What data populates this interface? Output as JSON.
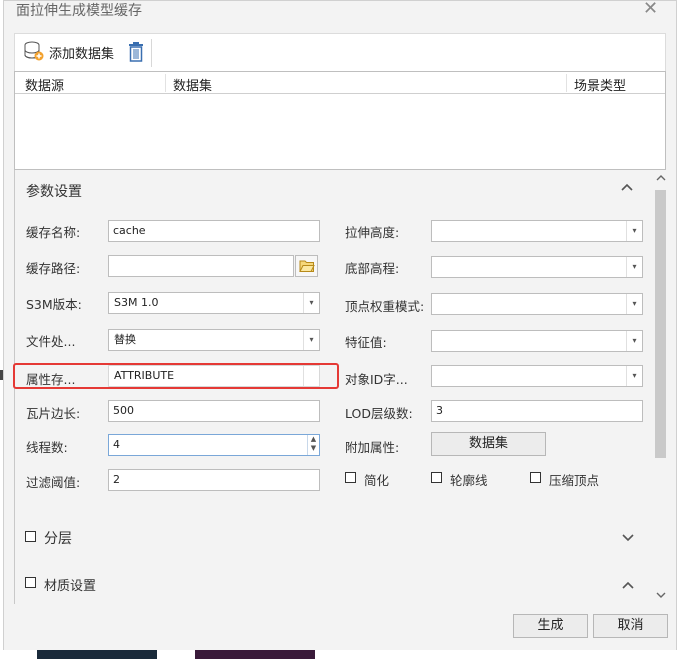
{
  "window": {
    "title": "面拉伸生成模型缓存",
    "close_glyph": "✕"
  },
  "toolbar": {
    "add_dataset_label": "添加数据集"
  },
  "dataset_table": {
    "columns": [
      "数据源",
      "数据集",
      "场景类型"
    ]
  },
  "params": {
    "section_title": "参数设置",
    "cache_name": {
      "label": "缓存名称:",
      "value": "cache"
    },
    "cache_path": {
      "label": "缓存路径:",
      "value": ""
    },
    "s3m_version": {
      "label": "S3M版本:",
      "value": "S3M 1.0"
    },
    "file_handling": {
      "label": "文件处...",
      "value": "替换"
    },
    "attr_storage": {
      "label": "属性存...",
      "value": "ATTRIBUTE"
    },
    "tile_side": {
      "label": "瓦片边长:",
      "value": "500"
    },
    "thread_count": {
      "label": "线程数:",
      "value": "4"
    },
    "filter_threshold": {
      "label": "过滤阈值:",
      "value": "2"
    },
    "extrude_height": {
      "label": "拉伸高度:",
      "value": ""
    },
    "base_elevation": {
      "label": "底部高程:",
      "value": ""
    },
    "vertex_weight_mode": {
      "label": "顶点权重模式:",
      "value": ""
    },
    "feature_value": {
      "label": "特征值:",
      "value": ""
    },
    "object_id_field": {
      "label": "对象ID字...",
      "value": ""
    },
    "lod_levels": {
      "label": "LOD层级数:",
      "value": "3"
    },
    "extra_attr": {
      "label": "附加属性:",
      "button": "数据集"
    },
    "simplify": "简化",
    "outline": "轮廓线",
    "compress_vertex": "压缩顶点"
  },
  "layering": {
    "label": "分层"
  },
  "material": {
    "label": "材质设置"
  },
  "footer": {
    "generate": "生成",
    "cancel": "取消"
  },
  "colors": {
    "highlight": "#e53935",
    "dialog_bg": "#f3f3f3"
  }
}
